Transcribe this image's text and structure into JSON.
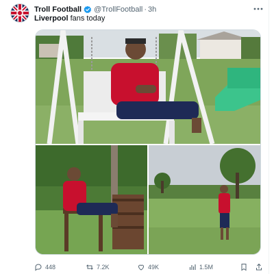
{
  "tweet": {
    "display_name": "Troll Football",
    "handle": "@TrollFootball",
    "separator": "·",
    "time": "3h",
    "text_bold": "Liverpool",
    "text_rest": " fans today"
  },
  "media": {
    "photo_count": 3
  },
  "actions": {
    "replies": "448",
    "retweets": "7.2K",
    "likes": "49K",
    "views": "1.5M"
  },
  "colors": {
    "text": "#0f1419",
    "muted": "#536471",
    "verified": "#1d9bf0",
    "border": "#cfd9de"
  },
  "icons": [
    "union-jack-avatar-icon",
    "verified-badge-icon",
    "more-icon",
    "reply-icon",
    "retweet-icon",
    "like-icon",
    "views-icon",
    "bookmark-icon",
    "share-icon"
  ]
}
